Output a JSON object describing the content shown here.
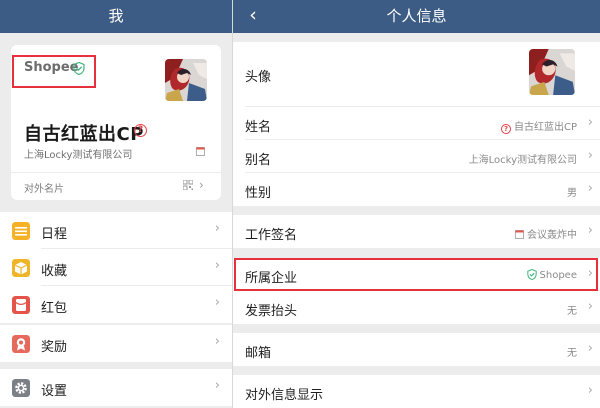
{
  "left_panel": {
    "title": "我",
    "card": {
      "company": "Shopee",
      "user_name": "自古红蓝出CP",
      "org": "上海Locky测试有限公司",
      "footer_label": "对外名片"
    },
    "menu_groups": [
      [
        {
          "label": "日程",
          "icon": "calendar-icon",
          "color": "#f5b227"
        },
        {
          "label": "收藏",
          "icon": "box-icon",
          "color": "#f0b429"
        },
        {
          "label": "红包",
          "icon": "red-packet-icon",
          "color": "#e5544a"
        }
      ],
      [
        {
          "label": "奖励",
          "icon": "award-icon",
          "color": "#e56a5b"
        }
      ],
      [
        {
          "label": "设置",
          "icon": "gear-icon",
          "color": "#7b7f86"
        }
      ]
    ]
  },
  "right_panel": {
    "title": "个人信息",
    "rows": {
      "avatar": {
        "label": "头像"
      },
      "name": {
        "label": "姓名",
        "value": "自古红蓝出CP"
      },
      "alias": {
        "label": "别名",
        "value": "上海Locky测试有限公司"
      },
      "gender": {
        "label": "性别",
        "value": "男"
      },
      "signature": {
        "label": "工作签名",
        "value": "会议轰炸中"
      },
      "company": {
        "label": "所属企业",
        "value": "Shopee"
      },
      "invoice": {
        "label": "发票抬头",
        "value": "无"
      },
      "email": {
        "label": "邮箱",
        "value": "无"
      },
      "external": {
        "label": "对外信息显示"
      }
    }
  },
  "colors": {
    "nav_bar": "#3d5c85",
    "highlight_border": "#e6303b",
    "verified_green": "#3bb37a"
  }
}
